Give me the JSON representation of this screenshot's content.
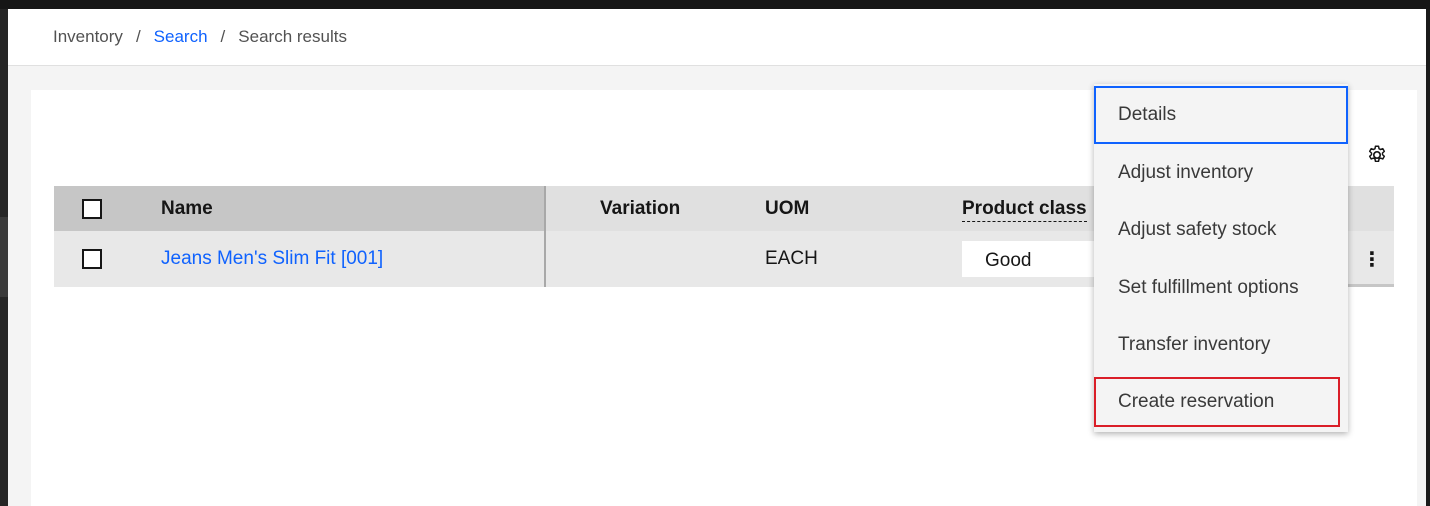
{
  "breadcrumb": {
    "items": [
      "Inventory",
      "Search",
      "Search results"
    ],
    "separator": "/"
  },
  "table": {
    "headers": {
      "name": "Name",
      "variation": "Variation",
      "uom": "UOM",
      "product_class": "Product class"
    },
    "rows": [
      {
        "name": "Jeans Men's Slim Fit [001]",
        "variation": "",
        "uom": "EACH",
        "product_class": "Good"
      }
    ]
  },
  "menu": {
    "items": [
      "Details",
      "Adjust inventory",
      "Adjust safety stock",
      "Set fulfillment options",
      "Transfer inventory",
      "Create reservation"
    ]
  },
  "icons": {
    "settings": "gear-icon",
    "overflow": "overflow-menu-vertical-icon",
    "overflow_glyph": "⋮"
  },
  "colors": {
    "link": "#0f62fe",
    "focus": "#0f62fe",
    "highlight": "#da1e28"
  }
}
